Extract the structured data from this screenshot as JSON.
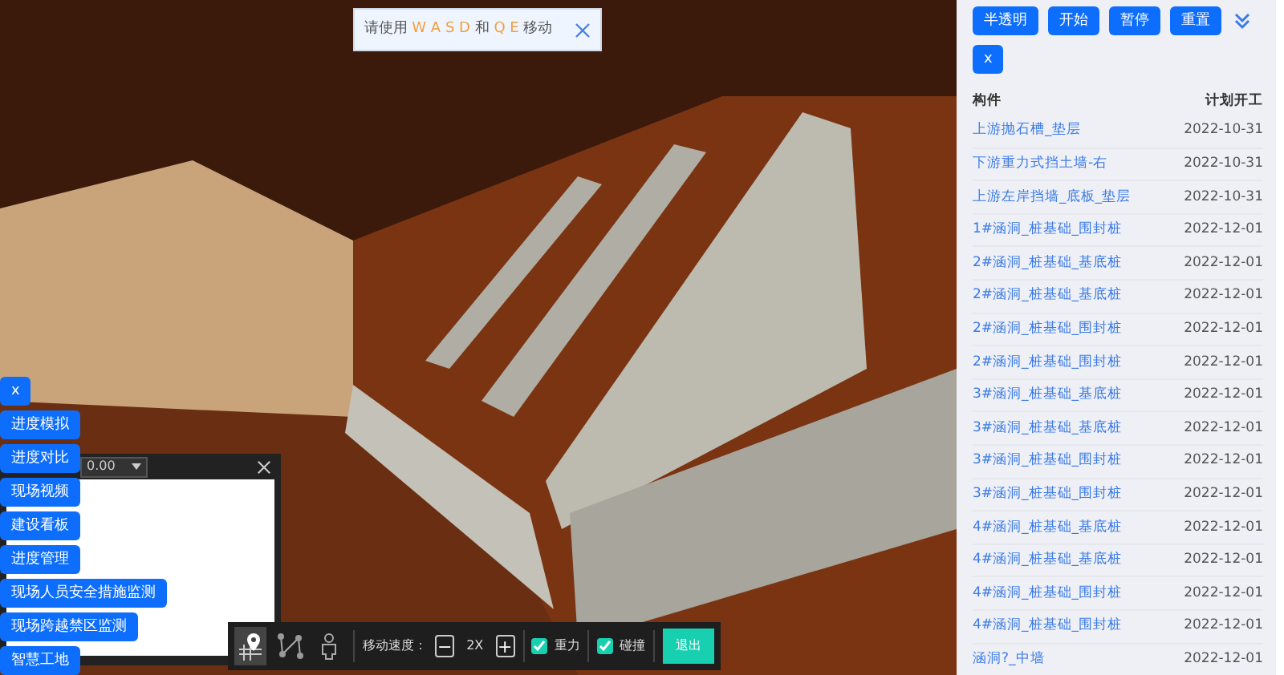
{
  "toast": {
    "text": "请使用 **W A S D** 和 **Q E** 移动"
  },
  "left_menu": {
    "close": "x",
    "items": [
      "进度模拟",
      "进度对比",
      "现场视频",
      "建设看板",
      "进度管理",
      "现场人员安全措施监测",
      "现场跨越禁区监测",
      "智慧工地"
    ]
  },
  "minimap": {
    "dropdown": "0.00"
  },
  "toolbar": {
    "tools": [
      {
        "kind": "pin",
        "selected": true
      },
      {
        "kind": "path",
        "selected": false
      },
      {
        "kind": "person",
        "selected": false
      }
    ],
    "speed_label": "移动速度：",
    "speed_minus": "−",
    "speed_value": "2X",
    "speed_plus": "+",
    "options": [
      {
        "label": "重力",
        "checked": true
      },
      {
        "label": "碰撞",
        "checked": true
      }
    ],
    "exit": "退出"
  },
  "panel": {
    "buttons": [
      "半透明",
      "开始",
      "暂停",
      "重置"
    ],
    "close": "x",
    "columns": [
      "构件",
      "计划开工"
    ],
    "rows": [
      {
        "name": "上游抛石槽_垫层",
        "date": "2022-10-31"
      },
      {
        "name": "下游重力式挡土墙-右",
        "date": "2022-10-31"
      },
      {
        "name": "上游左岸挡墙_底板_垫层",
        "date": "2022-10-31"
      },
      {
        "name": "1#涵洞_桩基础_围封桩",
        "date": "2022-12-01"
      },
      {
        "name": "2#涵洞_桩基础_基底桩",
        "date": "2022-12-01"
      },
      {
        "name": "2#涵洞_桩基础_基底桩",
        "date": "2022-12-01"
      },
      {
        "name": "2#涵洞_桩基础_围封桩",
        "date": "2022-12-01"
      },
      {
        "name": "2#涵洞_桩基础_围封桩",
        "date": "2022-12-01"
      },
      {
        "name": "3#涵洞_桩基础_基底桩",
        "date": "2022-12-01"
      },
      {
        "name": "3#涵洞_桩基础_基底桩",
        "date": "2022-12-01"
      },
      {
        "name": "3#涵洞_桩基础_围封桩",
        "date": "2022-12-01"
      },
      {
        "name": "3#涵洞_桩基础_围封桩",
        "date": "2022-12-01"
      },
      {
        "name": "4#涵洞_桩基础_基底桩",
        "date": "2022-12-01"
      },
      {
        "name": "4#涵洞_桩基础_基底桩",
        "date": "2022-12-01"
      },
      {
        "name": "4#涵洞_桩基础_围封桩",
        "date": "2022-12-01"
      },
      {
        "name": "4#涵洞_桩基础_围封桩",
        "date": "2022-12-01"
      },
      {
        "name": "涵洞?_中墙",
        "date": "2022-12-01"
      }
    ]
  }
}
